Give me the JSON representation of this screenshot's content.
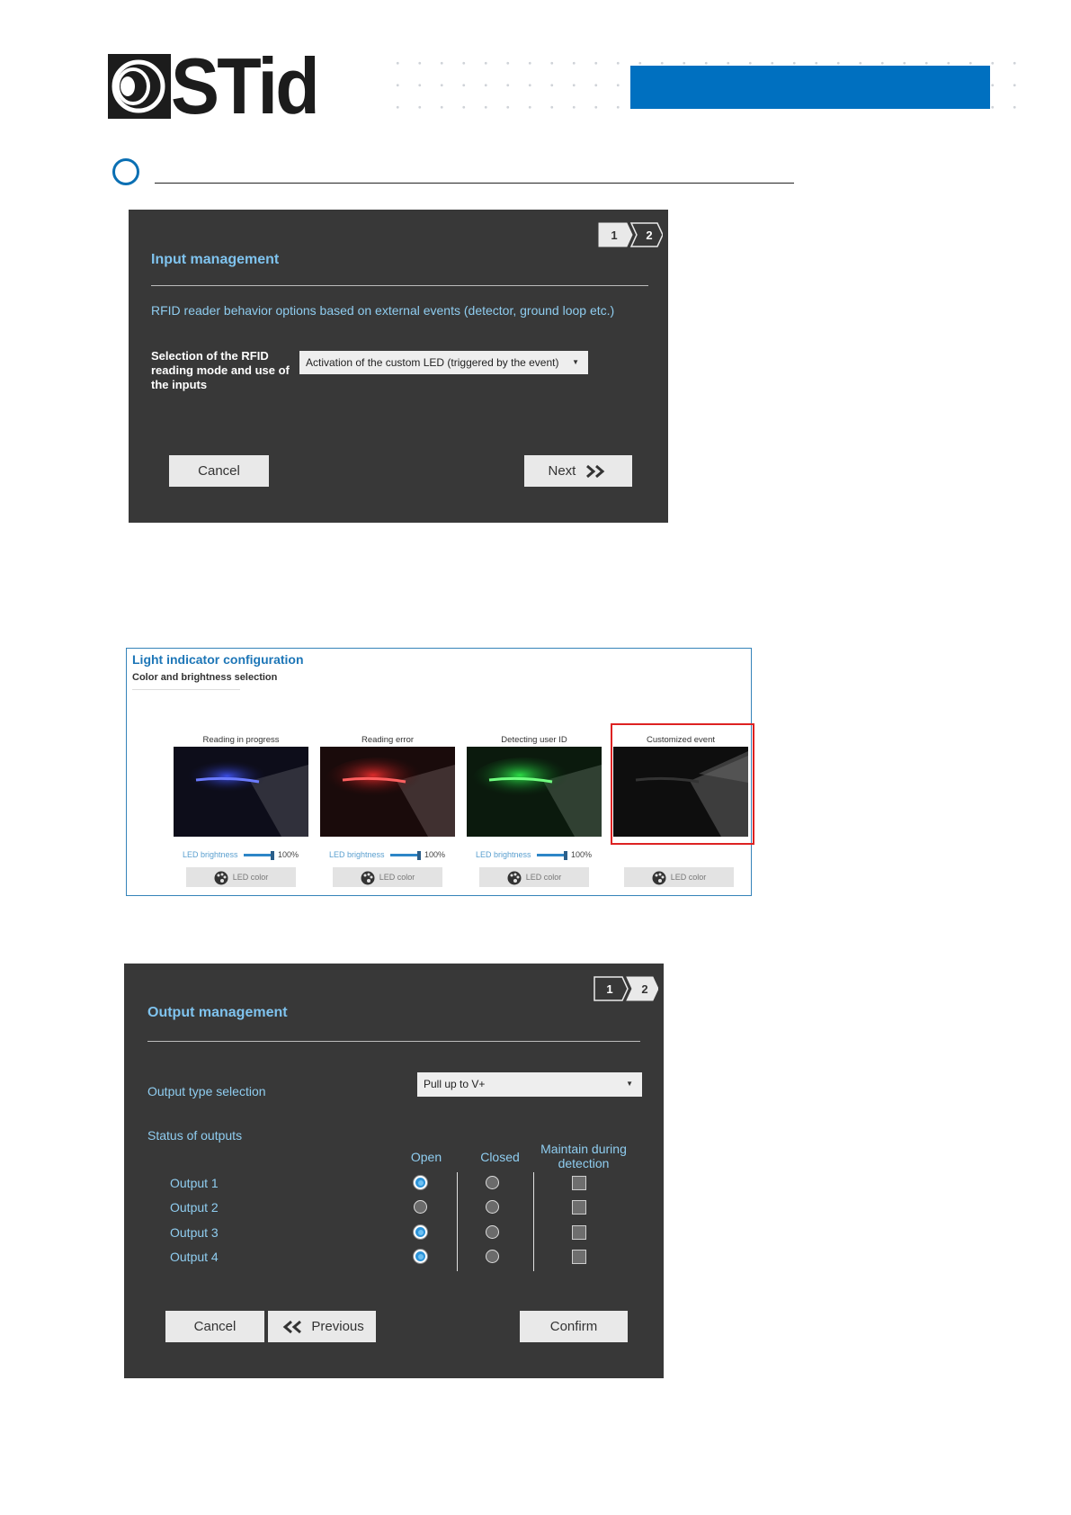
{
  "header": {
    "brand": "STid",
    "accent_color": "#0070c0"
  },
  "input_dialog": {
    "steps": [
      "1",
      "2"
    ],
    "title": "Input management",
    "description": "RFID reader behavior options based on external events (detector, ground loop etc.)",
    "field_label": "Selection of the RFID reading mode and use of the inputs",
    "selected_mode": "Activation of the custom LED (triggered by the event)",
    "cancel_label": "Cancel",
    "next_label": "Next"
  },
  "light_config": {
    "title": "Light indicator configuration",
    "subtitle": "Color and brightness selection",
    "cards": [
      {
        "name": "Reading in progress",
        "color": "#2b3bff",
        "brightness_label": "LED brightness",
        "brightness": "100%",
        "button": "LED color"
      },
      {
        "name": "Reading error",
        "color": "#ff2b2b",
        "brightness_label": "LED brightness",
        "brightness": "100%",
        "button": "LED color"
      },
      {
        "name": "Detecting user ID",
        "color": "#2bff4a",
        "brightness_label": "LED brightness",
        "brightness": "100%",
        "button": "LED color"
      },
      {
        "name": "Customized event",
        "color": "#111111",
        "button": "LED color"
      }
    ]
  },
  "output_dialog": {
    "steps": [
      "1",
      "2"
    ],
    "title": "Output management",
    "type_label": "Output type selection",
    "type_value": "Pull up to V+",
    "status_label": "Status of outputs",
    "col_open": "Open",
    "col_closed": "Closed",
    "col_maintain": "Maintain during detection",
    "outputs": [
      {
        "label": "Output 1",
        "state": "open"
      },
      {
        "label": "Output 2",
        "state": "none"
      },
      {
        "label": "Output 3",
        "state": "open"
      },
      {
        "label": "Output 4",
        "state": "open"
      }
    ],
    "cancel_label": "Cancel",
    "previous_label": "Previous",
    "confirm_label": "Confirm"
  }
}
